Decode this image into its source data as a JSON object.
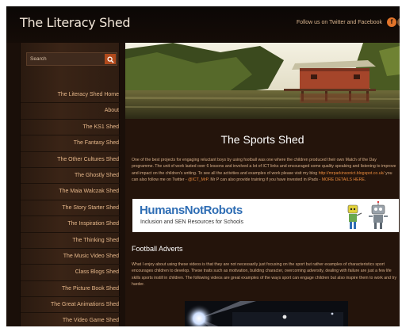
{
  "header": {
    "site_title": "The Literacy Shed",
    "follow_text": "Follow us on Twitter and Facebook",
    "social_icons": [
      "facebook-icon",
      "twitter-icon"
    ]
  },
  "sidebar": {
    "search_placeholder": "Search",
    "search_icon": "search-icon",
    "items": [
      "The Literacy Shed Home",
      "About",
      "The KS1 Shed",
      "The Fantasy Shed",
      "The Other Cultures Shed",
      "The Ghostly Shed",
      "The Maia Walczak Shed",
      "The Story Starter Shed",
      "The Inspiration Shed",
      "The Thinking Shed",
      "The Music Video Shed",
      "Class Blogs Shed",
      "The Picture Book Shed",
      "The Great Animations Shed",
      "The Video Game Shed"
    ]
  },
  "main": {
    "heading": "The Sports Shed",
    "intro_a": "One of the best projects for engaging reluctant boys by using football was one where the children produced their own Match of the Day programme. The unit of work lasted over 6 lessons and involved a lot of ICT links and encouraged some quality speaking and listening to improve and impact on the children's writing. To see all the activities and examples of work please visit my blog ",
    "intro_link1": "http://mrparkinsonict.blogspot.co.uk/",
    "intro_b": " you can also follow me on Twitter - ",
    "intro_link2": "@ICT_MrP",
    "intro_c": ". Mr P can also provide training if you have invested in iPads - ",
    "intro_link3": "MORE DETAILS HERE",
    "intro_d": ".",
    "banner": {
      "brand": "HumansNotRobots",
      "tagline": "Inclusion and SEN Resources for Schools"
    },
    "section_heading": "Football Adverts",
    "adverts_text": "What I enjoy about using these videos is that they are not necessarily just focusing on the sport but rather examples of characteristics sport encourages children to develop. These traits such as motivation, building character, overcoming adversity, dealing with failure are just a few life skills sports instill in children. The following videos are great examples of the ways sport can engage children but also inspire them to work and try harder."
  },
  "colors": {
    "background": "#1a0f09",
    "accent": "#e98a3c",
    "nav_text": "#e6b78a",
    "search_button": "#b14a1c"
  }
}
